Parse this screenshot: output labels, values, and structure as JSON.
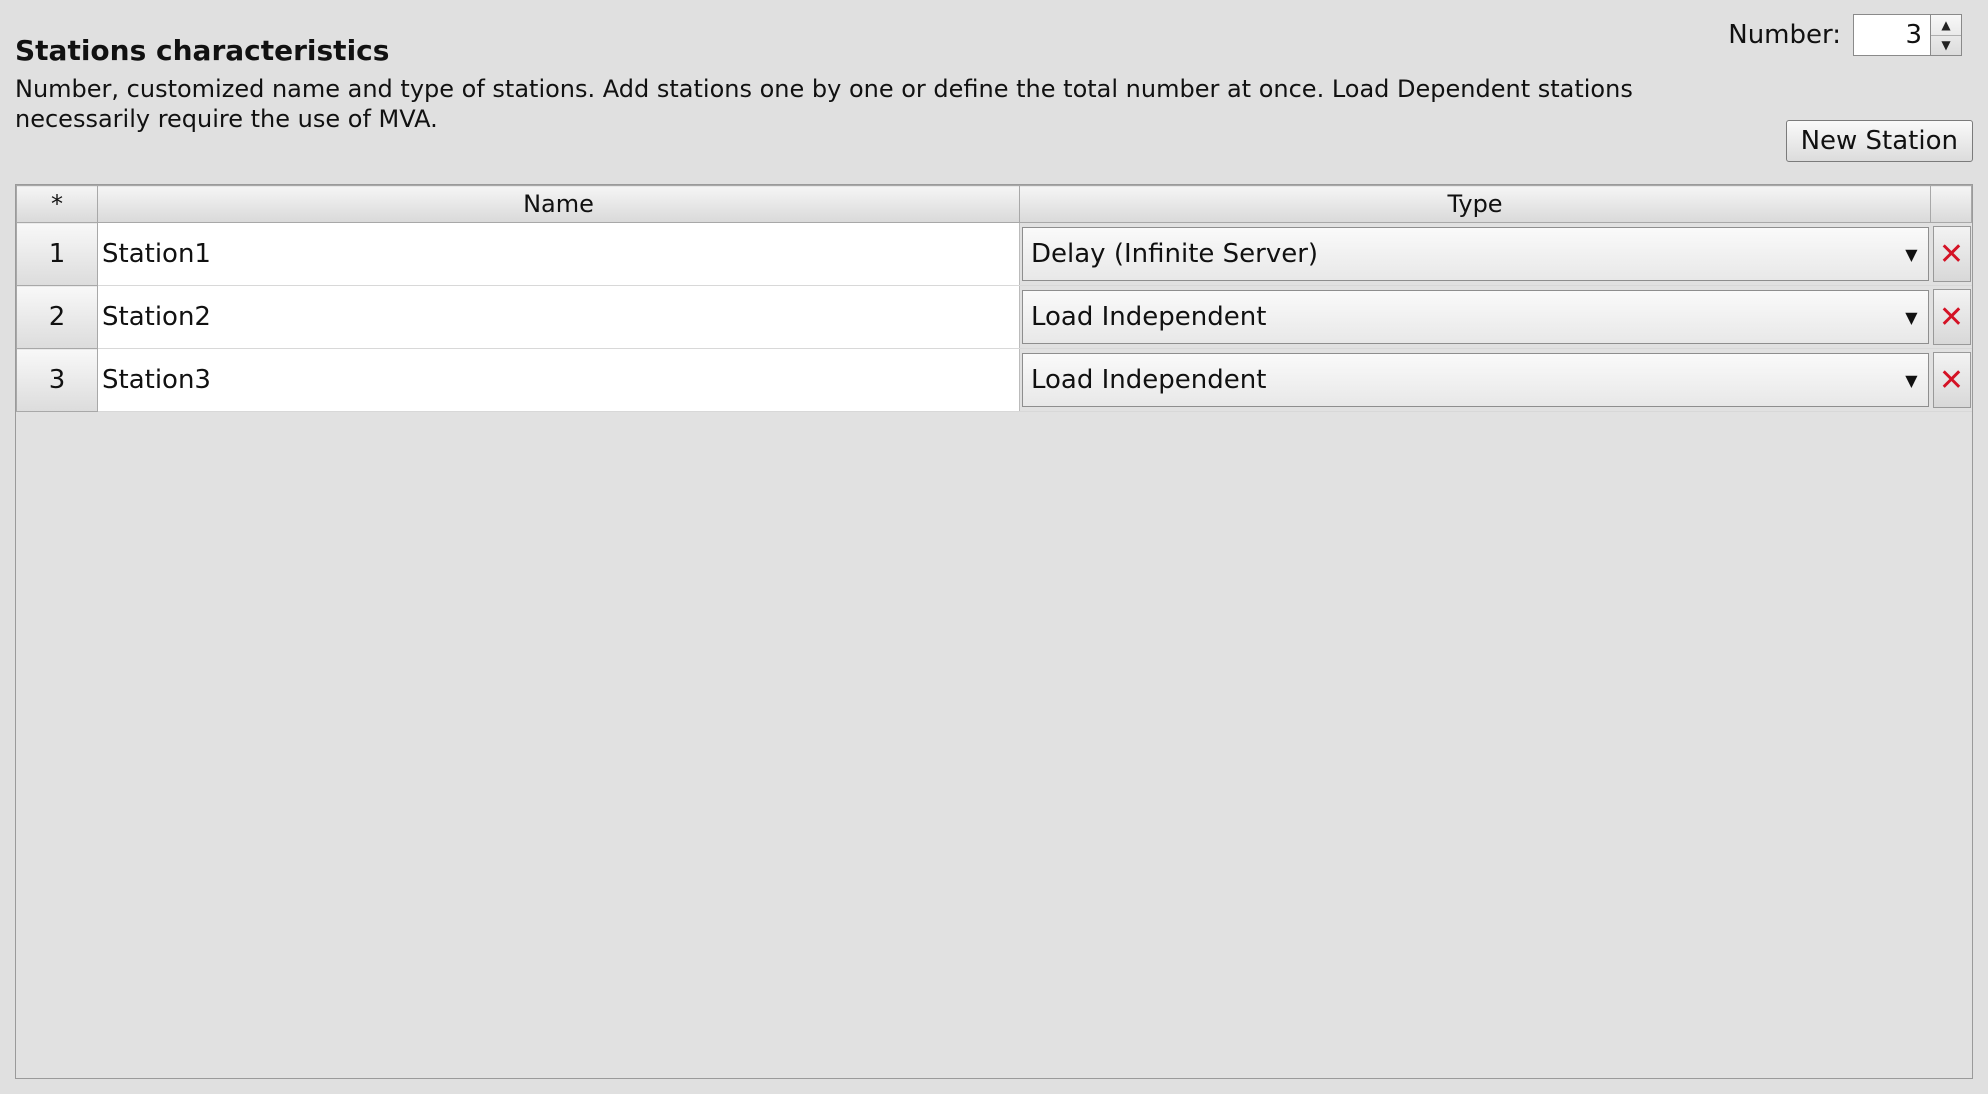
{
  "header": {
    "title": "Stations characteristics",
    "description": "Number, customized name and type of stations. Add stations one by one or define the total number at once. Load Dependent stations necessarily require the use of MVA."
  },
  "number_control": {
    "label": "Number:",
    "value": "3"
  },
  "new_station_button": "New Station",
  "table": {
    "headers": {
      "index": "*",
      "name": "Name",
      "type": "Type"
    },
    "rows": [
      {
        "index": "1",
        "name": "Station1",
        "type": "Delay (Infinite Server)"
      },
      {
        "index": "2",
        "name": "Station2",
        "type": "Load Independent"
      },
      {
        "index": "3",
        "name": "Station3",
        "type": "Load Independent"
      }
    ]
  },
  "icons": {
    "delete": "close-icon",
    "dropdown": "chevron-down-icon",
    "spinner_up": "chevron-up-icon",
    "spinner_down": "chevron-down-icon"
  },
  "colors": {
    "delete_icon": "#d41225",
    "background": "#e0e0e0"
  }
}
